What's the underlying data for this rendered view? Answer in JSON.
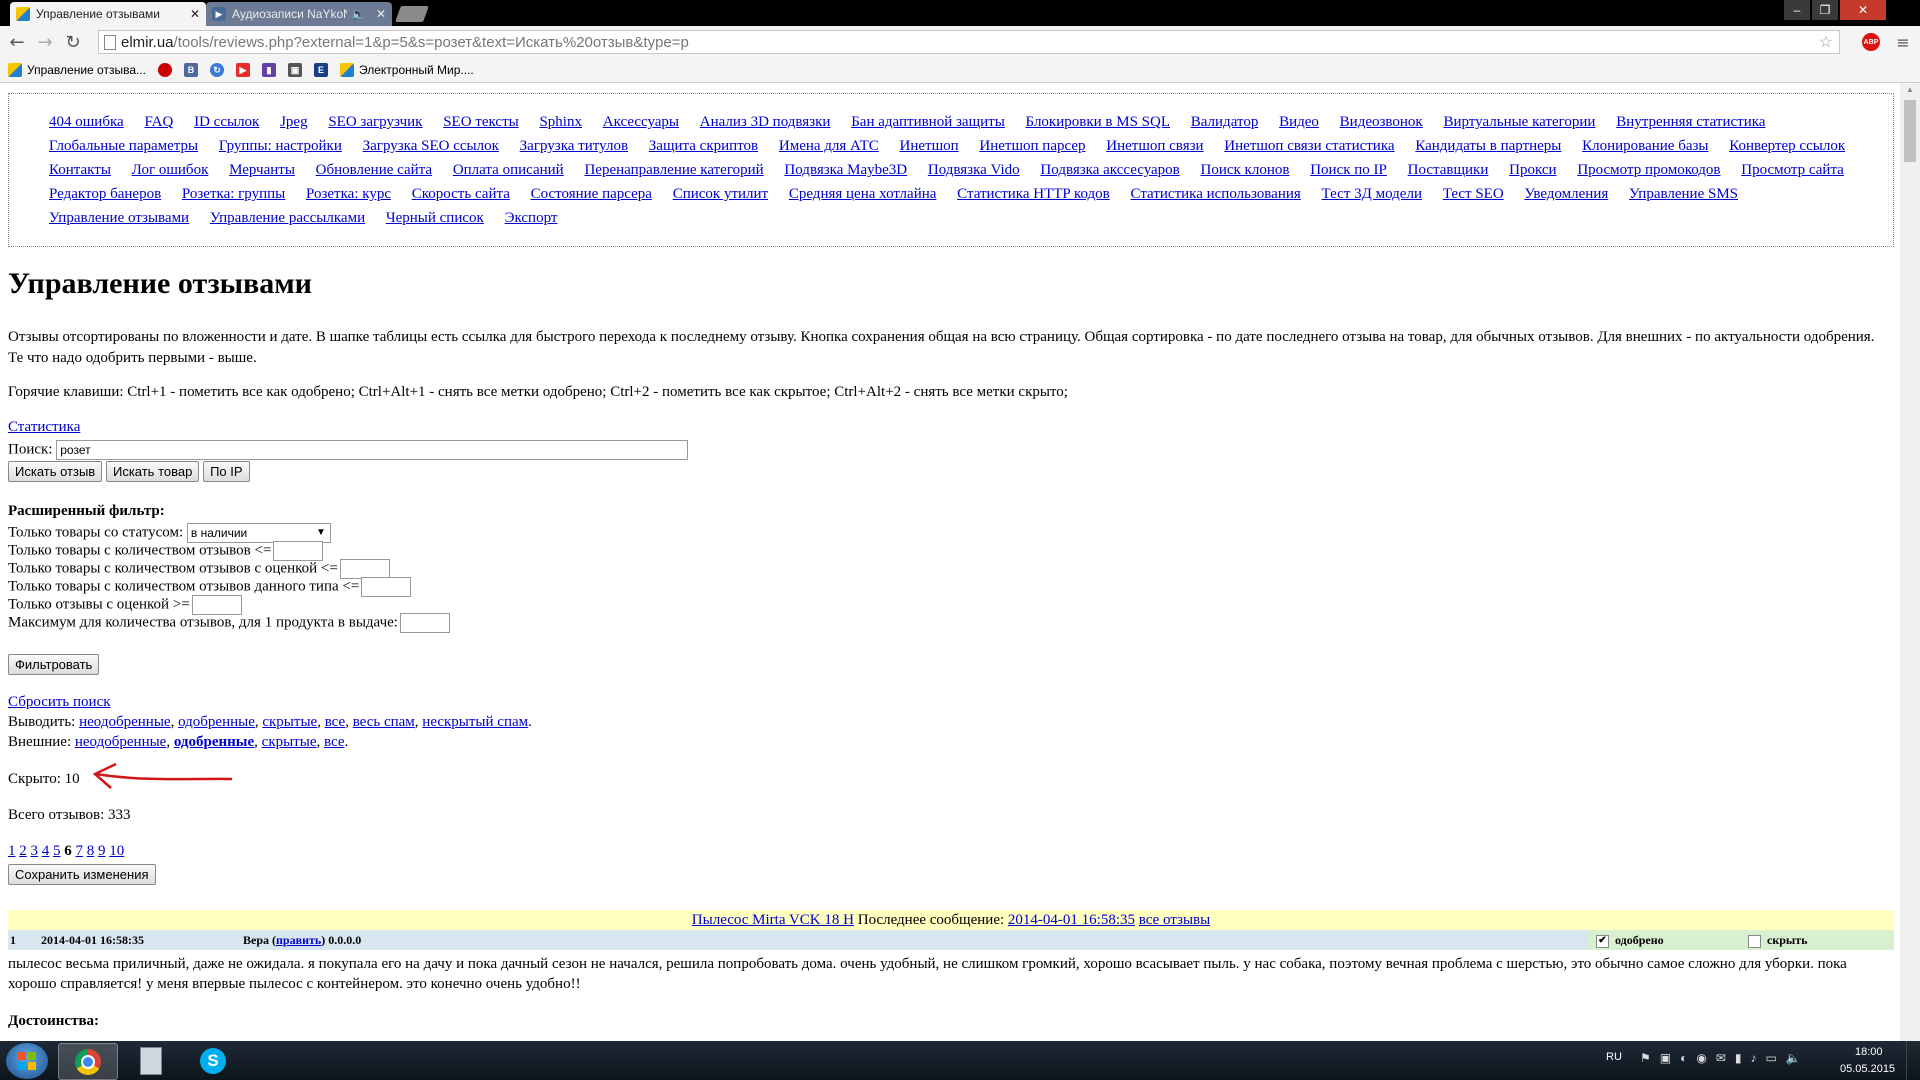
{
  "browser": {
    "tabs": [
      {
        "title": "Управление отзывами",
        "active": true
      },
      {
        "title": "Аудиозаписи NaYkoN",
        "active": false
      }
    ],
    "url_host": "elmir.ua",
    "url_path": "/tools/reviews.php?external=1&p=5&s=розет&text=Искать%20отзыв&type=p",
    "bookmarks": [
      {
        "label": "Управление отзыва...",
        "icon": "elmir-icon"
      },
      {
        "label": "",
        "icon": "bookmark-red-icon"
      },
      {
        "label": "",
        "icon": "vk-icon"
      },
      {
        "label": "",
        "icon": "chrome-sync-icon"
      },
      {
        "label": "",
        "icon": "youtube-icon"
      },
      {
        "label": "",
        "icon": "twitch-icon"
      },
      {
        "label": "",
        "icon": "video-icon"
      },
      {
        "label": "",
        "icon": "e-icon"
      },
      {
        "label": "Электронный Мир....",
        "icon": "elmir-icon"
      }
    ]
  },
  "menu": [
    "404 ошибка",
    "FAQ",
    "ID ссылок",
    "Jpeg",
    "SEO загрузчик",
    "SEO тексты",
    "Sphinx",
    "Аксессуары",
    "Анализ 3D подвязки",
    "Бан адаптивной защиты",
    "Блокировки в MS SQL",
    "Валидатор",
    "Видео",
    "Видеозвонок",
    "Виртуальные категории",
    "Внутренняя статистика",
    "Глобальные параметры",
    "Группы: настройки",
    "Загрузка SEO ссылок",
    "Загрузка титулов",
    "Защита скриптов",
    "Имена для АТС",
    "Инетшоп",
    "Инетшоп парсер",
    "Инетшоп связи",
    "Инетшоп связи статистика",
    "Кандидаты в партнеры",
    "Клонирование базы",
    "Конвертер ссылок",
    "Контакты",
    "Лог ошибок",
    "Мерчанты",
    "Обновление сайта",
    "Оплата описаний",
    "Перенаправление категорий",
    "Подвязка Maybe3D",
    "Подвязка Vido",
    "Подвязка акссесуаров",
    "Поиск клонов",
    "Поиск по IP",
    "Поставщики",
    "Прокси",
    "Просмотр промокодов",
    "Просмотр сайта",
    "Редактор банеров",
    "Розетка: группы",
    "Розетка: курс",
    "Скорость сайта",
    "Состояние парсера",
    "Список утилит",
    "Средняя цена хотлайна",
    "Статистика HTTP кодов",
    "Статистика использования",
    "Тест 3Д модели",
    "Тест SEO",
    "Уведомления",
    "Управление SMS",
    "Управление отзывами",
    "Управление рассылками",
    "Черный список",
    "Экспорт"
  ],
  "page": {
    "title": "Управление отзывами",
    "desc": "Отзывы отсортированы по вложенности и дате. В шапке таблицы есть ссылка для быстрого перехода к последнему отзыву. Кнопка сохранения общая на всю страницу. Общая сортировка - по дате последнего отзыва на товар, для обычных отзывов. Для внешних - по актуальности одобрения. Те что надо одобрить первыми - выше.",
    "hotkeys": "Горячие клавиши: Ctrl+1 - пометить все как одобрено; Ctrl+Alt+1 - снять все метки одобрено; Ctrl+2 - пометить все как скрытое; Ctrl+Alt+2 - снять все метки скрыто;",
    "stats_link": "Статистика",
    "search_label": "Поиск:",
    "search_value": "розет",
    "btn_search_review": "Искать отзыв",
    "btn_search_product": "Искать товар",
    "btn_by_ip": "По IP",
    "filter_title": "Расширенный фильтр:",
    "filter_status_label": "Только товары со статусом:",
    "filter_status_value": "в наличии",
    "filter_rows": [
      "Только товары с количеством отзывов <=",
      "Только товары с количеством отзывов с оценкой <=",
      "Только товары с количеством отзывов данного типа <=",
      "Только отзывы с оценкой >=",
      "Максимум для количества отзывов, для 1 продукта в выдаче:"
    ],
    "btn_filter": "Фильтровать",
    "reset_search": "Сбросить поиск",
    "output_label": "Выводить:",
    "output_links": [
      "неодобренные",
      "одобренные",
      "скрытые",
      "все",
      "весь спам",
      "нескрытый спам"
    ],
    "external_label": "Внешние:",
    "external_links": [
      "неодобренные",
      "одобренные",
      "скрытые",
      "все"
    ],
    "hidden_text": "Скрыто: 10",
    "total_text": "Всего отзывов: 333",
    "pages": [
      "1",
      "2",
      "3",
      "4",
      "5",
      "6",
      "7",
      "8",
      "9",
      "10"
    ],
    "current_page": "6",
    "btn_save": "Сохранить изменения"
  },
  "review": {
    "product_link": "Пылесос Mirta VCK 18 H",
    "last_msg_label": "Последнее сообщение:",
    "last_msg_date": "2014-04-01 16:58:35",
    "all_reviews": "все отзывы",
    "num": "1",
    "date": "2014-04-01 16:58:35",
    "author": "Вера",
    "edit_link": "править",
    "ip": "0.0.0.0",
    "approved_label": "одобрено",
    "approved_checked": true,
    "hide_label": "скрыть",
    "hide_checked": false,
    "text": "пылесос весьма приличный, даже не ожидала. я покупала его на дачу и пока дачный сезон не начался, решила попробовать дома. очень удобный, не слишком громкий, хорошо всасывает пыль. у нас собака, поэтому вечная проблема с шерстью, это обычно самое сложно для уборки. пока хорошо справляется! у меня впервые пылесос с контейнером. это конечно очень удобно!!",
    "pros_label": "Достоинства:"
  },
  "taskbar": {
    "lang": "RU",
    "time": "18:00",
    "date": "05.05.2015"
  },
  "colors": {
    "link": "#0000cc",
    "review_head_bg": "#ffffc0",
    "review_meta_bg": "#d8e6f0",
    "review_checks_bg": "#d8f0d0",
    "annotation_arrow": "#d01818"
  }
}
